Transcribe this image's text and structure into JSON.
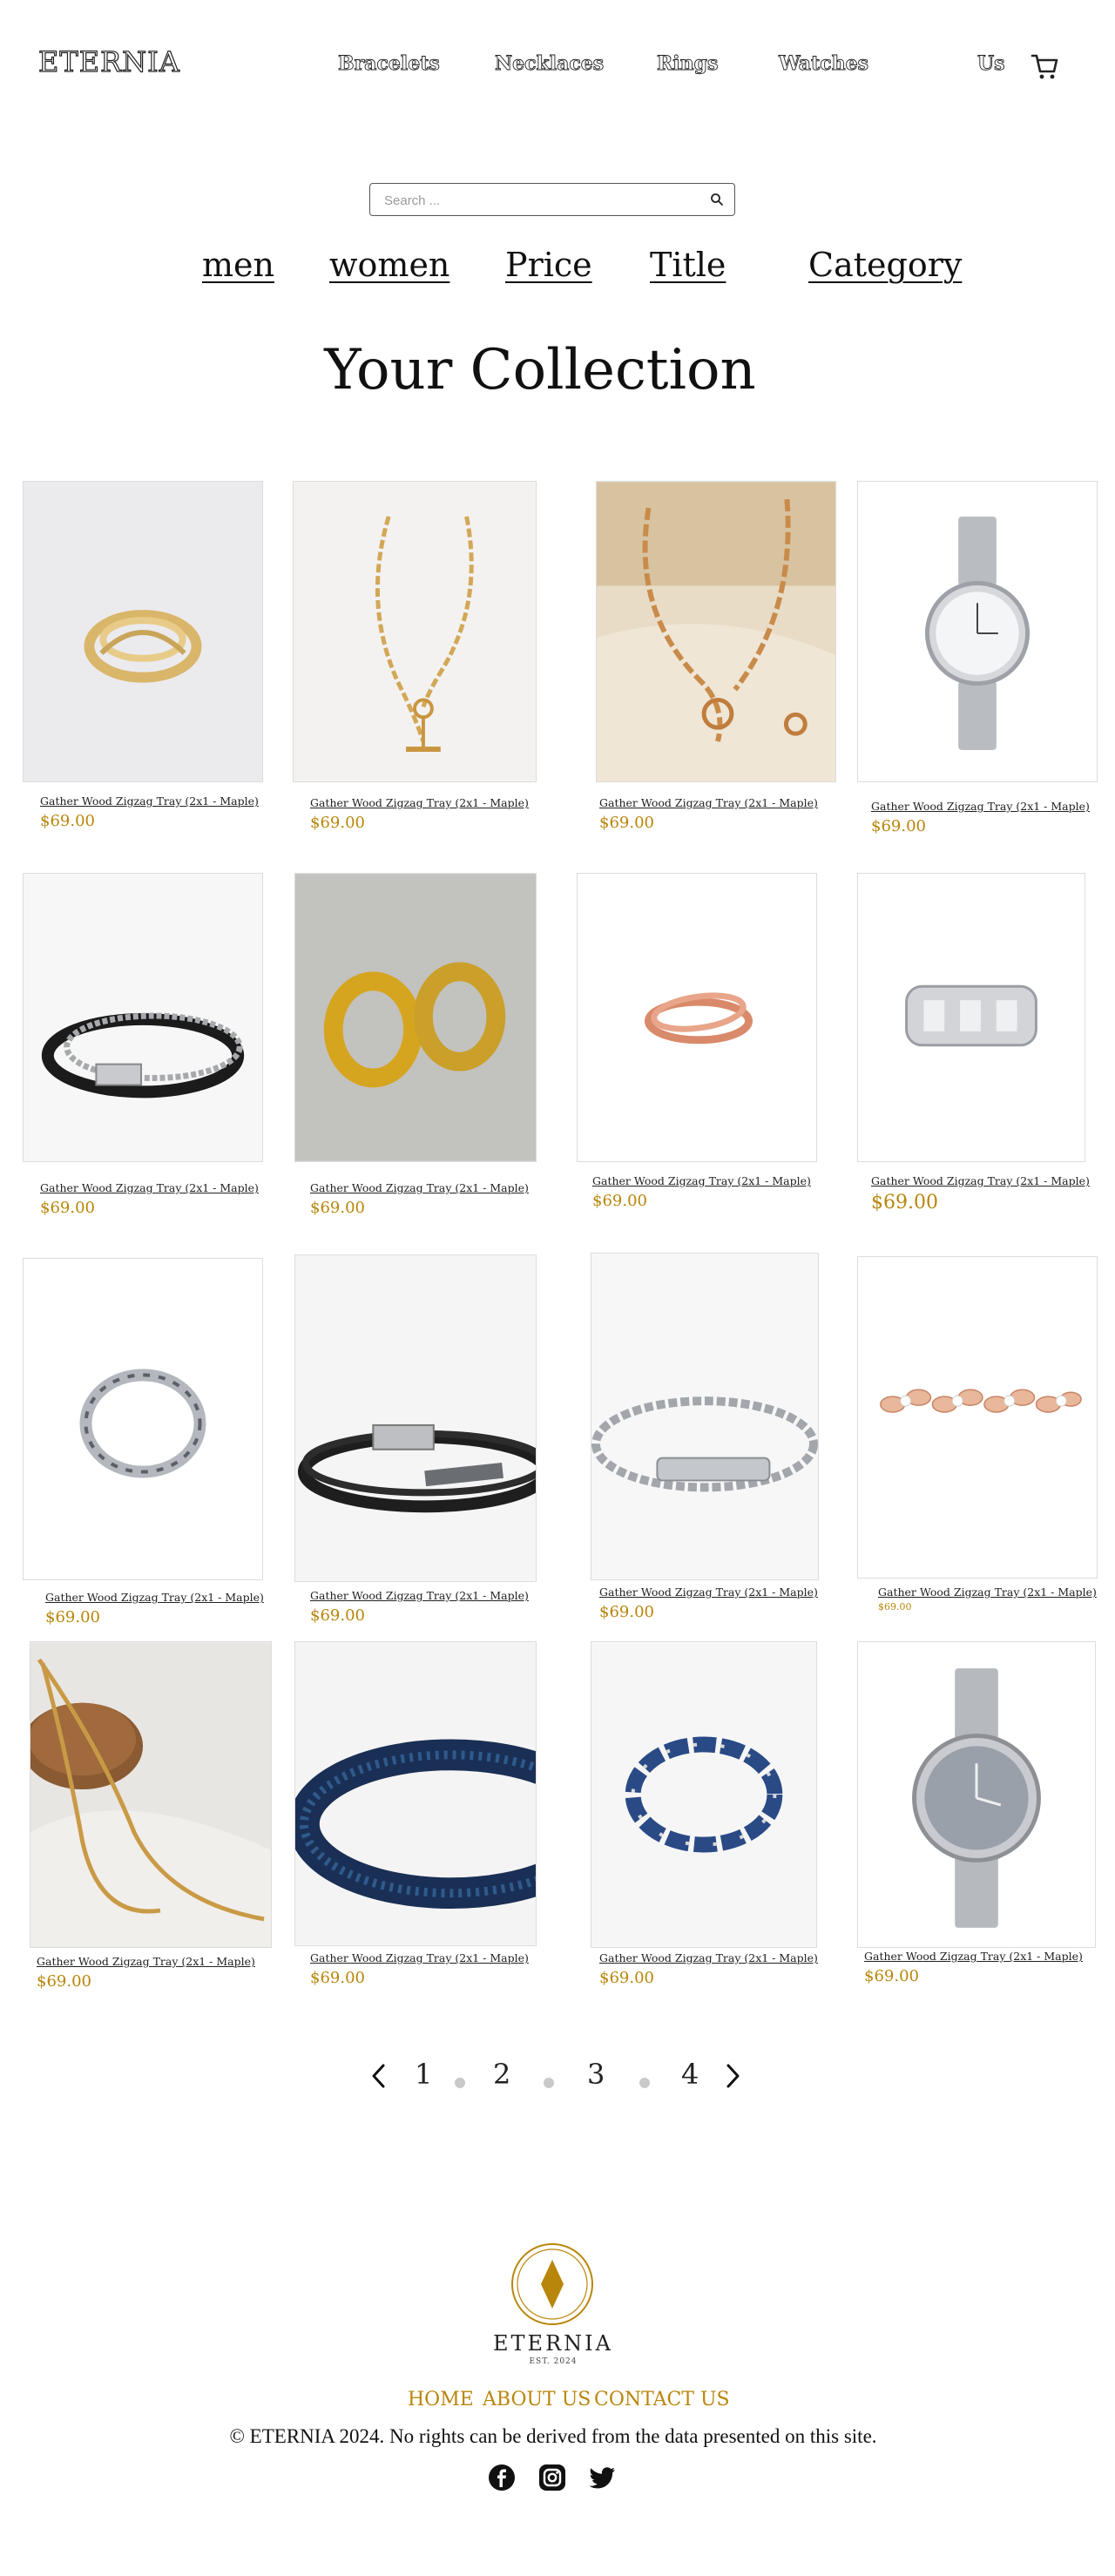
{
  "header": {
    "logo": "ETERNIA",
    "nav": [
      "Bracelets",
      "Necklaces",
      "Rings",
      "Watches"
    ],
    "us_label": "Us",
    "cart_icon": "cart-icon"
  },
  "search": {
    "placeholder": "Search ...",
    "value": ""
  },
  "filters": [
    "men",
    "women",
    "Price",
    "Title",
    "Category"
  ],
  "heading": "Your Collection",
  "products": [
    {
      "title": "Gather Wood Zigzag Tray (2x1 - Maple)",
      "price": "$69.00",
      "image": "gold-cuff-bracelet"
    },
    {
      "title": "Gather Wood Zigzag Tray (2x1 - Maple)",
      "price": "$69.00",
      "image": "gold-chain-toggle-necklace"
    },
    {
      "title": "Gather Wood Zigzag Tray (2x1 - Maple)",
      "price": "$69.00",
      "image": "gold-link-necklace-on-book"
    },
    {
      "title": "Gather Wood Zigzag Tray (2x1 - Maple)",
      "price": "$69.00",
      "image": "silver-wristwatch"
    },
    {
      "title": "Gather Wood Zigzag Tray (2x1 - Maple)",
      "price": "$69.00",
      "image": "black-silver-chain-bracelet"
    },
    {
      "title": "Gather Wood Zigzag Tray (2x1 - Maple)",
      "price": "$69.00",
      "image": "gold-hoop-earrings"
    },
    {
      "title": "Gather Wood Zigzag Tray (2x1 - Maple)",
      "price": "$69.00",
      "image": "rose-gold-crossover-ring"
    },
    {
      "title": "Gather Wood Zigzag Tray (2x1 - Maple)",
      "price": "$69.00",
      "image": "silver-geometric-ring"
    },
    {
      "title": "Gather Wood Zigzag Tray (2x1 - Maple)",
      "price": "$69.00",
      "image": "silver-pattern-ring"
    },
    {
      "title": "Gather Wood Zigzag Tray (2x1 - Maple)",
      "price": "$69.00",
      "image": "black-leather-bracelet"
    },
    {
      "title": "Gather Wood Zigzag Tray (2x1 - Maple)",
      "price": "$69.00",
      "image": "silver-id-bracelet"
    },
    {
      "title": "Gather Wood Zigzag Tray (2x1 - Maple)",
      "price": "$69.00",
      "image": "rose-gold-diamond-band"
    },
    {
      "title": "Gather Wood Zigzag Tray (2x1 - Maple)",
      "price": "$69.00",
      "image": "gold-herringbone-necklace"
    },
    {
      "title": "Gather Wood Zigzag Tray (2x1 - Maple)",
      "price": "$69.00",
      "image": "blue-beaded-bracelet"
    },
    {
      "title": "Gather Wood Zigzag Tray (2x1 - Maple)",
      "price": "$69.00",
      "image": "blue-bead-bracelet"
    },
    {
      "title": "Gather Wood Zigzag Tray (2x1 - Maple)",
      "price": "$69.00",
      "image": "silver-roman-watch"
    }
  ],
  "pagination": {
    "pages": [
      "1",
      "2",
      "3",
      "4"
    ],
    "prev_icon": "chevron-left-icon",
    "next_icon": "chevron-right-icon"
  },
  "footer": {
    "brand": "ETERNIA",
    "est": "EST. 2024",
    "links": [
      "HOME",
      "ABOUT US",
      "CONTACT US"
    ],
    "copyright": "© ETERNIA 2024.  No rights can be derived from the data presented on this site.",
    "social": [
      "facebook-icon",
      "instagram-icon",
      "twitter-icon"
    ]
  },
  "colors": {
    "accent": "#b8860b",
    "text": "#111111",
    "border": "#dcdcdc"
  }
}
